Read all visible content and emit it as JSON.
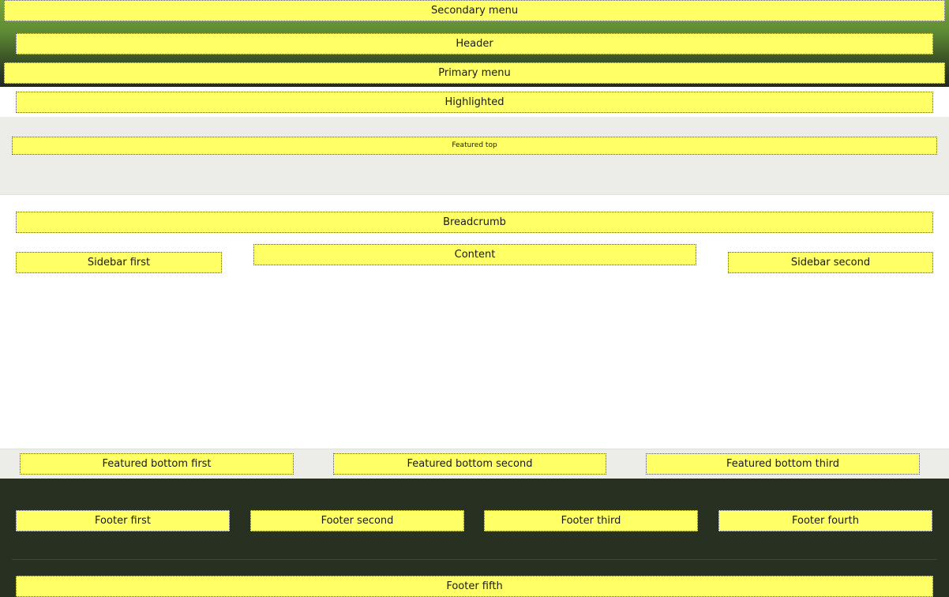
{
  "regions": {
    "secondary_menu": "Secondary menu",
    "header": "Header",
    "primary_menu": "Primary menu",
    "highlighted": "Highlighted",
    "featured_top": "Featured top",
    "breadcrumb": "Breadcrumb",
    "sidebar_first": "Sidebar first",
    "content": "Content",
    "sidebar_second": "Sidebar second",
    "featured_bottom_first": "Featured bottom first",
    "featured_bottom_second": "Featured bottom second",
    "featured_bottom_third": "Featured bottom third",
    "footer_first": "Footer first",
    "footer_second": "Footer second",
    "footer_third": "Footer third",
    "footer_fourth": "Footer fourth",
    "footer_fifth": "Footer fifth"
  },
  "colors": {
    "region_fill": "#ffff66",
    "header_gradient_top": "#77a53b",
    "header_gradient_bottom": "#222a20",
    "featured_background": "#ecede9",
    "footer_background": "#283022"
  }
}
